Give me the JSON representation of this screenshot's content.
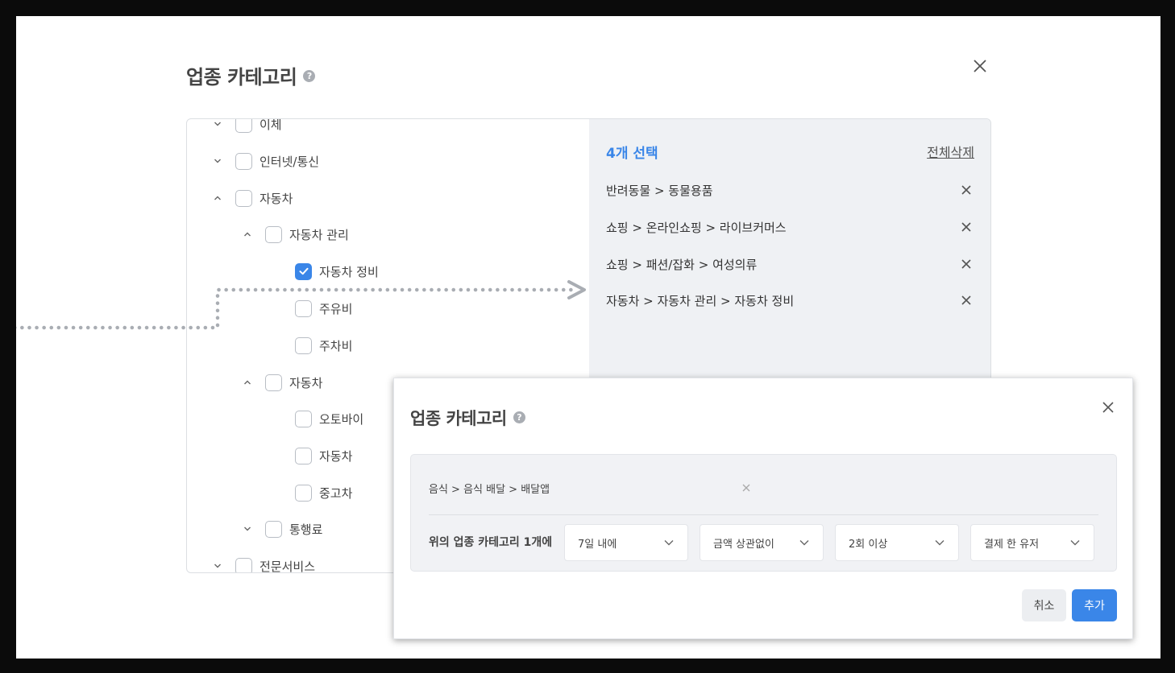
{
  "back_modal": {
    "title": "업종 카테고리",
    "help_glyph": "?",
    "tree": [
      {
        "label": "이체",
        "chevron": "down",
        "checked": false
      },
      {
        "label": "인터넷/통신",
        "chevron": "down",
        "checked": false
      },
      {
        "label": "자동차",
        "chevron": "up",
        "checked": false
      },
      {
        "label": "자동차 관리",
        "chevron": "up",
        "checked": false
      },
      {
        "label": "자동차 정비",
        "chevron": "none",
        "checked": true
      },
      {
        "label": "주유비",
        "chevron": "none",
        "checked": false
      },
      {
        "label": "주차비",
        "chevron": "none",
        "checked": false
      },
      {
        "label": "자동차",
        "chevron": "up",
        "checked": false
      },
      {
        "label": "오토바이",
        "chevron": "none",
        "checked": false
      },
      {
        "label": "자동차",
        "chevron": "none",
        "checked": false
      },
      {
        "label": "중고차",
        "chevron": "none",
        "checked": false
      },
      {
        "label": "통행료",
        "chevron": "down",
        "checked": false
      },
      {
        "label": "전문서비스",
        "chevron": "down",
        "checked": false
      }
    ],
    "selection": {
      "count_label": "4개 선택",
      "clear_all": "전체삭제",
      "items": [
        "반려동물 > 동물용품",
        "쇼핑 > 온라인쇼핑 > 라이브커머스",
        "쇼핑 > 패션/잡화 > 여성의류",
        "자동차 > 자동차 관리 > 자동차 정비"
      ]
    }
  },
  "front_modal": {
    "title": "업종 카테고리",
    "help_glyph": "?",
    "path": "음식 > 음식 배달 > 배달앱",
    "condition_label": "위의 업종 카테고리 1개에",
    "dropdowns": [
      "7일 내에",
      "금액 상관없이",
      "2회 이상",
      "결제 한 유저"
    ],
    "cancel": "취소",
    "add": "추가"
  },
  "colors": {
    "accent": "#3a86e8",
    "panel_bg": "#eff1f4",
    "dotted_connector": "#a9adb3"
  }
}
